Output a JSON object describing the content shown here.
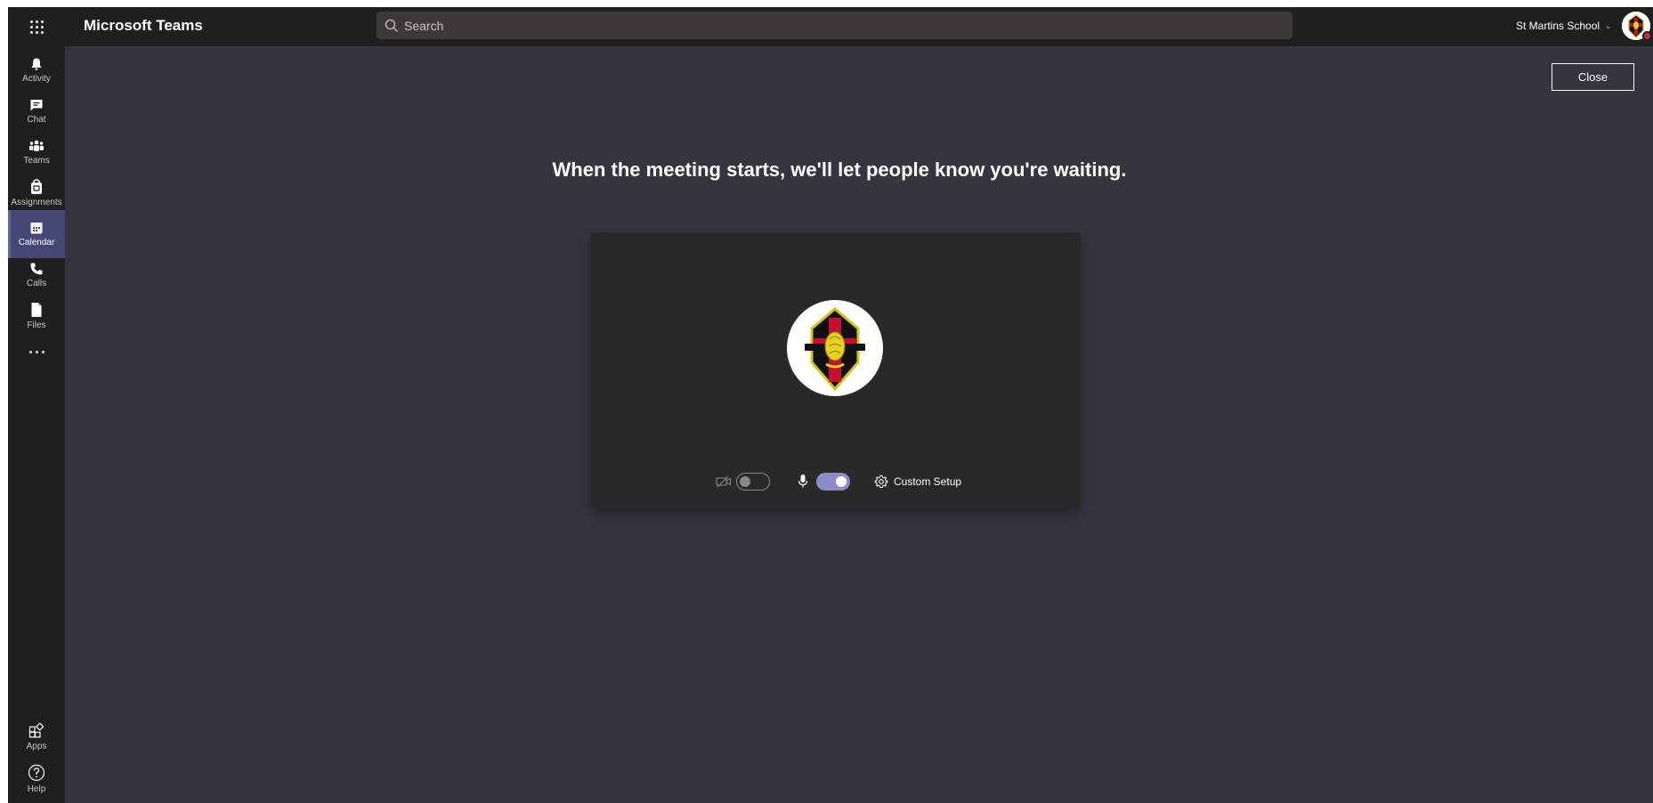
{
  "topbar": {
    "app_title": "Microsoft Teams",
    "search_placeholder": "Search",
    "tenant_name": "St Martins School",
    "avatar_status": "busy"
  },
  "rail": {
    "items": [
      {
        "label": "Activity",
        "icon": "bell-icon"
      },
      {
        "label": "Chat",
        "icon": "chat-icon"
      },
      {
        "label": "Teams",
        "icon": "teams-icon"
      },
      {
        "label": "Assignments",
        "icon": "assignments-icon"
      },
      {
        "label": "Calendar",
        "icon": "calendar-icon",
        "active": true
      },
      {
        "label": "Calls",
        "icon": "phone-icon"
      },
      {
        "label": "Files",
        "icon": "files-icon"
      }
    ],
    "bottom": [
      {
        "label": "Apps",
        "icon": "apps-icon"
      },
      {
        "label": "Help",
        "icon": "help-icon"
      }
    ]
  },
  "main": {
    "close_label": "Close",
    "waiting_message": "When the meeting starts, we'll let people know you're waiting.",
    "video_enabled": false,
    "mic_enabled": true,
    "custom_setup_label": "Custom Setup"
  },
  "colors": {
    "rail_bg": "#1f1f1f",
    "main_bg": "#36353f",
    "active_item": "#464775",
    "toggle_on": "#8b8cc7",
    "status_busy": "#c4314b"
  }
}
